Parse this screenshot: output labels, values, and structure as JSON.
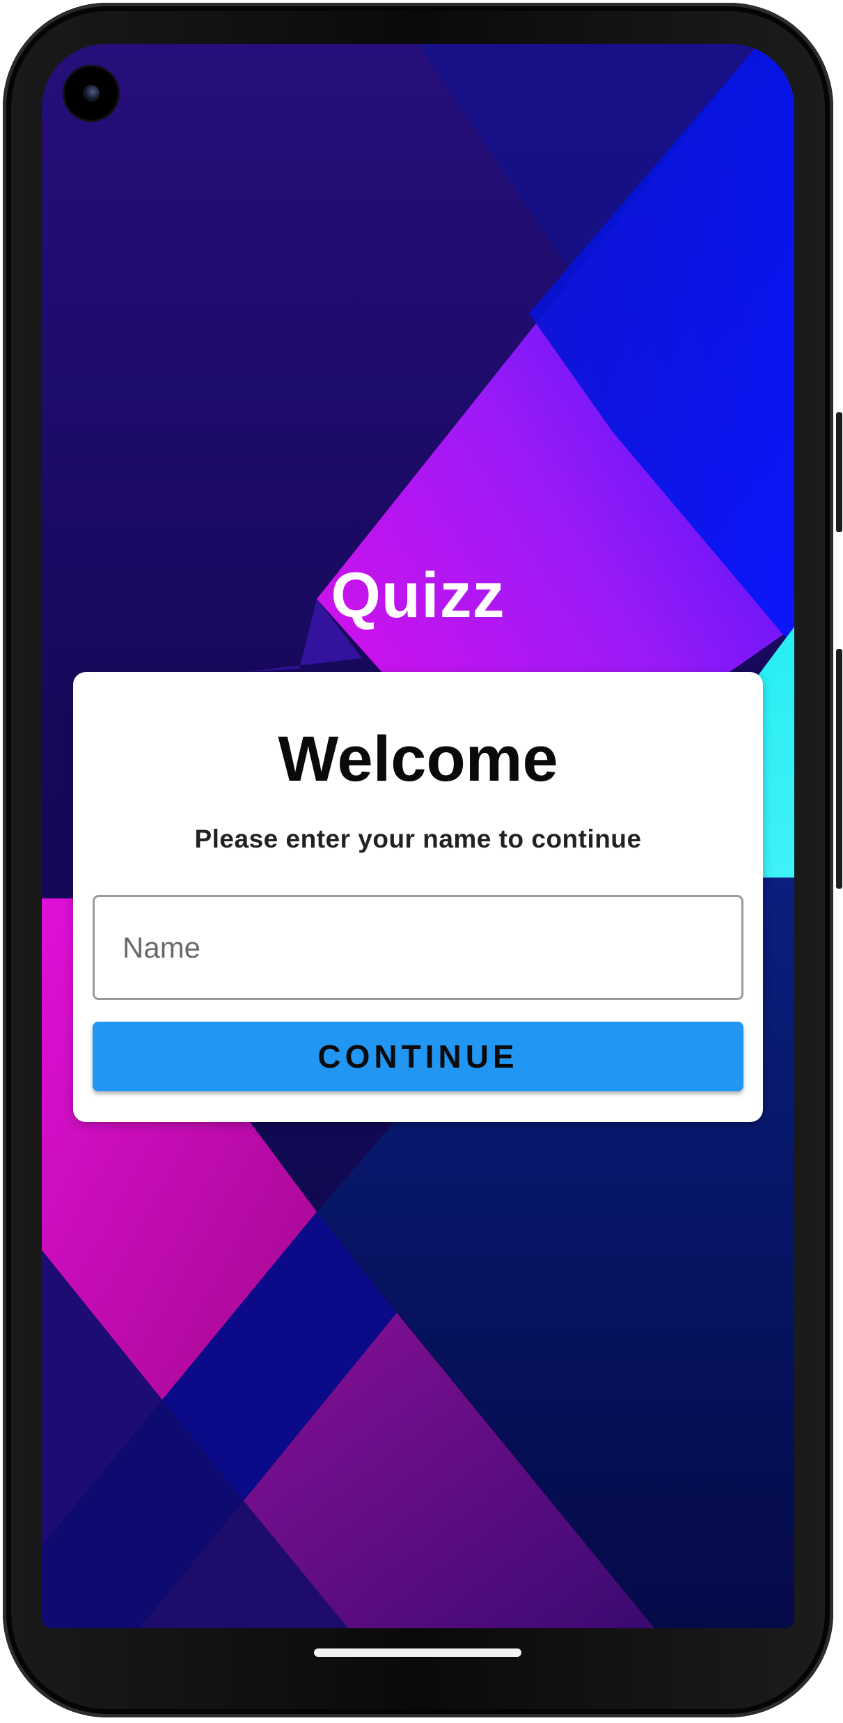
{
  "app": {
    "title": "Quizz"
  },
  "welcome_card": {
    "heading": "Welcome",
    "subtitle": "Please enter your name to continue",
    "name_input": {
      "placeholder": "Name",
      "value": ""
    },
    "continue_button": {
      "label": "CONTINUE"
    }
  },
  "colors": {
    "button_background": "#2196f3",
    "card_background": "#ffffff",
    "background_magenta": "#d012e0",
    "background_blue": "#0a1af0",
    "background_cyan": "#22f0f4",
    "background_navy": "#140a4e"
  },
  "icons": {
    "camera": "front-camera-icon",
    "home_indicator": "gesture-bar-icon"
  }
}
